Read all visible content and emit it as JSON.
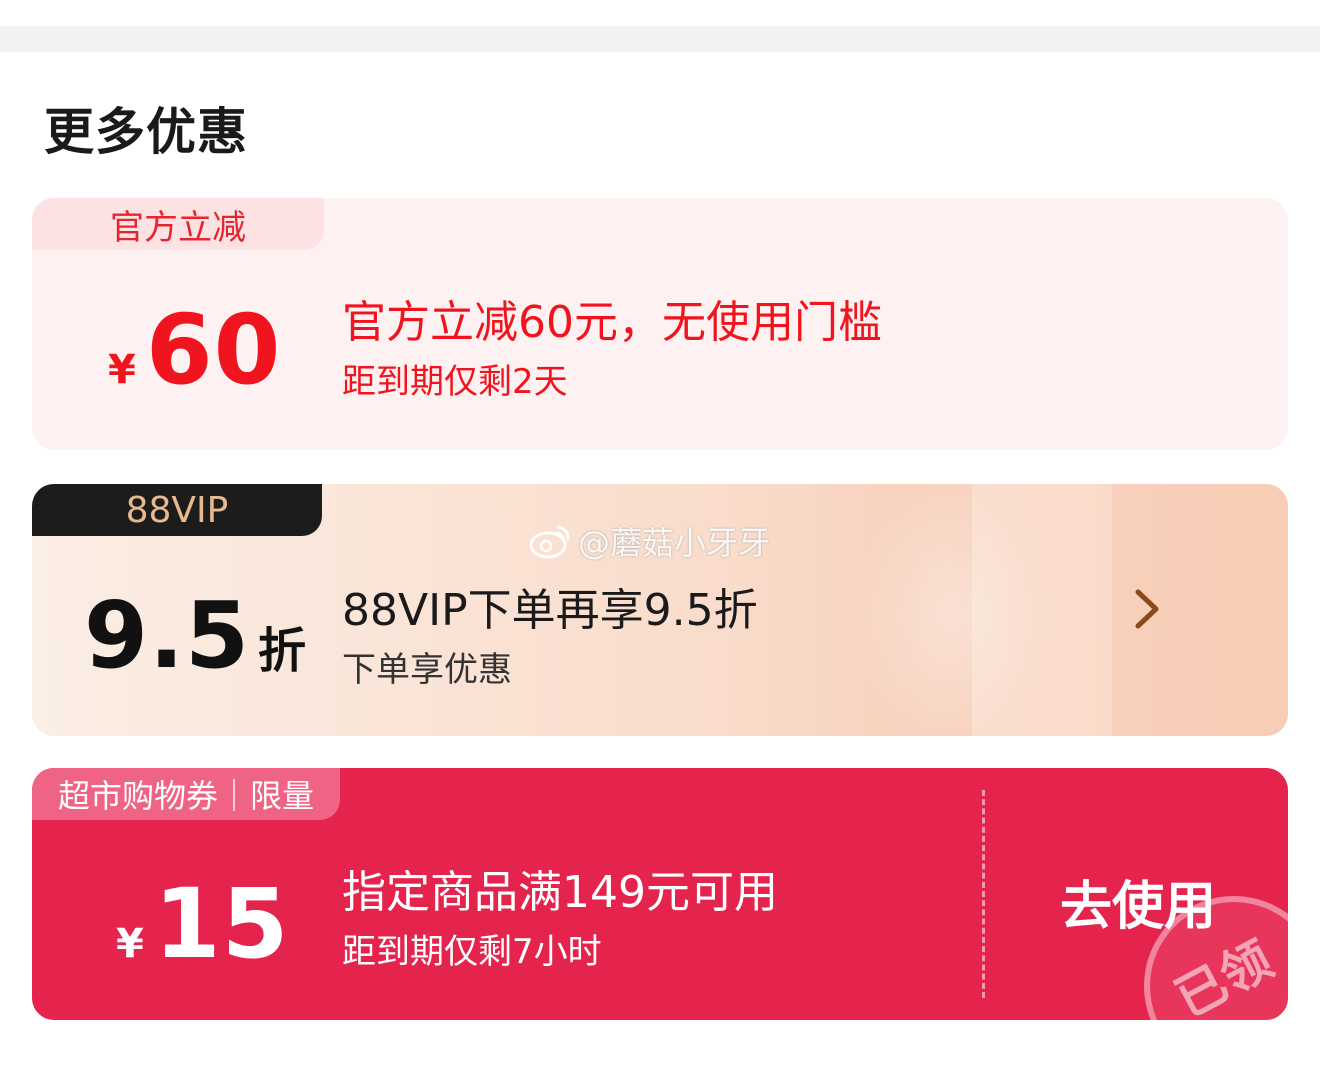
{
  "section_title": "更多优惠",
  "cards": [
    {
      "tag": "官方立减",
      "currency": "¥",
      "amount": "60",
      "title": "官方立减60元，无使用门槛",
      "subtitle": "距到期仅剩2天"
    },
    {
      "tag": "88VIP",
      "amount": "9.5",
      "unit": "折",
      "title": "88VIP下单再享9.5折",
      "subtitle": "下单享优惠",
      "action_icon": "chevron-right-icon"
    },
    {
      "tag": "超市购物券｜限量",
      "currency": "¥",
      "amount": "15",
      "title": "指定商品满149元可用",
      "subtitle": "距到期仅剩7小时",
      "action_label": "去使用",
      "stamp": "已领"
    }
  ],
  "watermark": "@蘑菇小牙牙",
  "colors": {
    "accent_red": "#f0141e",
    "card3_bg": "#e5244e",
    "vip_tag_bg": "#1c1c1c",
    "vip_tag_text": "#e8b98f"
  }
}
